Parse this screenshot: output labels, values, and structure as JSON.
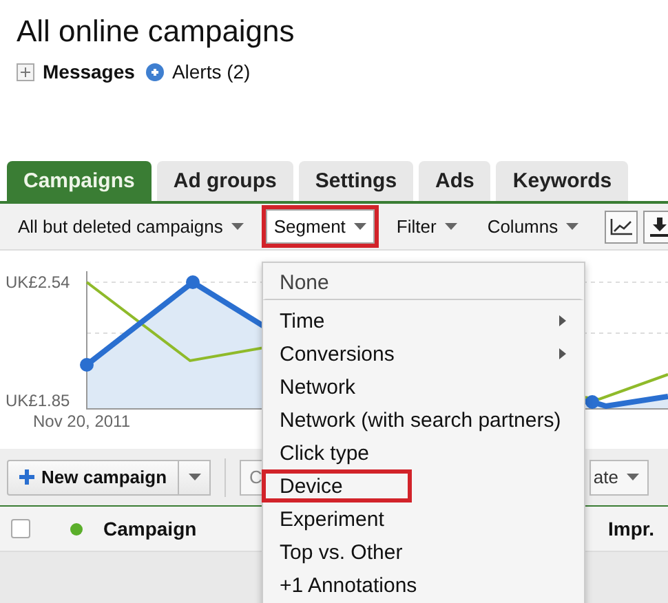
{
  "page_title": "All online campaigns",
  "messages": {
    "label": "Messages",
    "expanded": false
  },
  "alerts": {
    "label": "Alerts (2)"
  },
  "tabs": [
    {
      "label": "Campaigns",
      "selected": true
    },
    {
      "label": "Ad groups",
      "selected": false
    },
    {
      "label": "Settings",
      "selected": false
    },
    {
      "label": "Ads",
      "selected": false
    },
    {
      "label": "Keywords",
      "selected": false
    }
  ],
  "toolbar": [
    {
      "label": "All but deleted campaigns",
      "highlighted": false
    },
    {
      "label": "Segment",
      "highlighted": true
    },
    {
      "label": "Filter",
      "highlighted": false
    },
    {
      "label": "Columns",
      "highlighted": false
    }
  ],
  "chart": {
    "y_labels": [
      "UK£2.54",
      "UK£1.85"
    ],
    "x_label": "Nov 20, 2011"
  },
  "actions": {
    "new_campaign": "New campaign",
    "button_2": "C",
    "button_3": "ate"
  },
  "table": {
    "select_all_checked": false,
    "columns": [
      "Campaign",
      "Impr."
    ]
  },
  "segment_menu": [
    {
      "label": "None",
      "kind": "header",
      "highlighted": false
    },
    {
      "label": "Time",
      "kind": "submenu",
      "highlighted": false
    },
    {
      "label": "Conversions",
      "kind": "submenu",
      "highlighted": false
    },
    {
      "label": "Network",
      "kind": "item",
      "highlighted": false
    },
    {
      "label": "Network (with search partners)",
      "kind": "item",
      "highlighted": false
    },
    {
      "label": "Click type",
      "kind": "item",
      "highlighted": false
    },
    {
      "label": "Device",
      "kind": "item",
      "highlighted": true
    },
    {
      "label": "Experiment",
      "kind": "item",
      "highlighted": false
    },
    {
      "label": "Top vs. Other",
      "kind": "item",
      "highlighted": false
    },
    {
      "label": "+1 Annotations",
      "kind": "item",
      "highlighted": false
    }
  ]
}
